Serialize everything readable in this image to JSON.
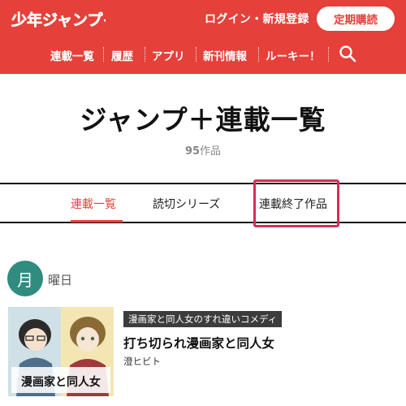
{
  "header": {
    "logo_text": "少年ジャンプ+",
    "login_label": "ログイン・新規登録",
    "subscribe_label": "定期購読",
    "brand_color": "#e5403a",
    "nav": [
      "連載一覧",
      "履歴",
      "アプリ",
      "新刊情報",
      "ルーキー！"
    ],
    "search_icon": "search-icon"
  },
  "main": {
    "title": "ジャンプ＋連載一覧",
    "count_number": "95",
    "count_suffix": "作品"
  },
  "tabs": {
    "items": [
      "連載一覧",
      "読切シリーズ",
      "連載終了作品"
    ],
    "active_index": 0,
    "highlighted_index": 2,
    "highlight_color": "#d72c55"
  },
  "day_section": {
    "day": "月",
    "suffix": "曜日",
    "badge_color": "#2f8c7f"
  },
  "series": [
    {
      "tagline": "漫画家と同人女のすれ違いコメディ",
      "title": "打ち切られ漫画家と同人女",
      "author": "澄ヒビト",
      "cover_text": "漫画家と同人女"
    }
  ]
}
